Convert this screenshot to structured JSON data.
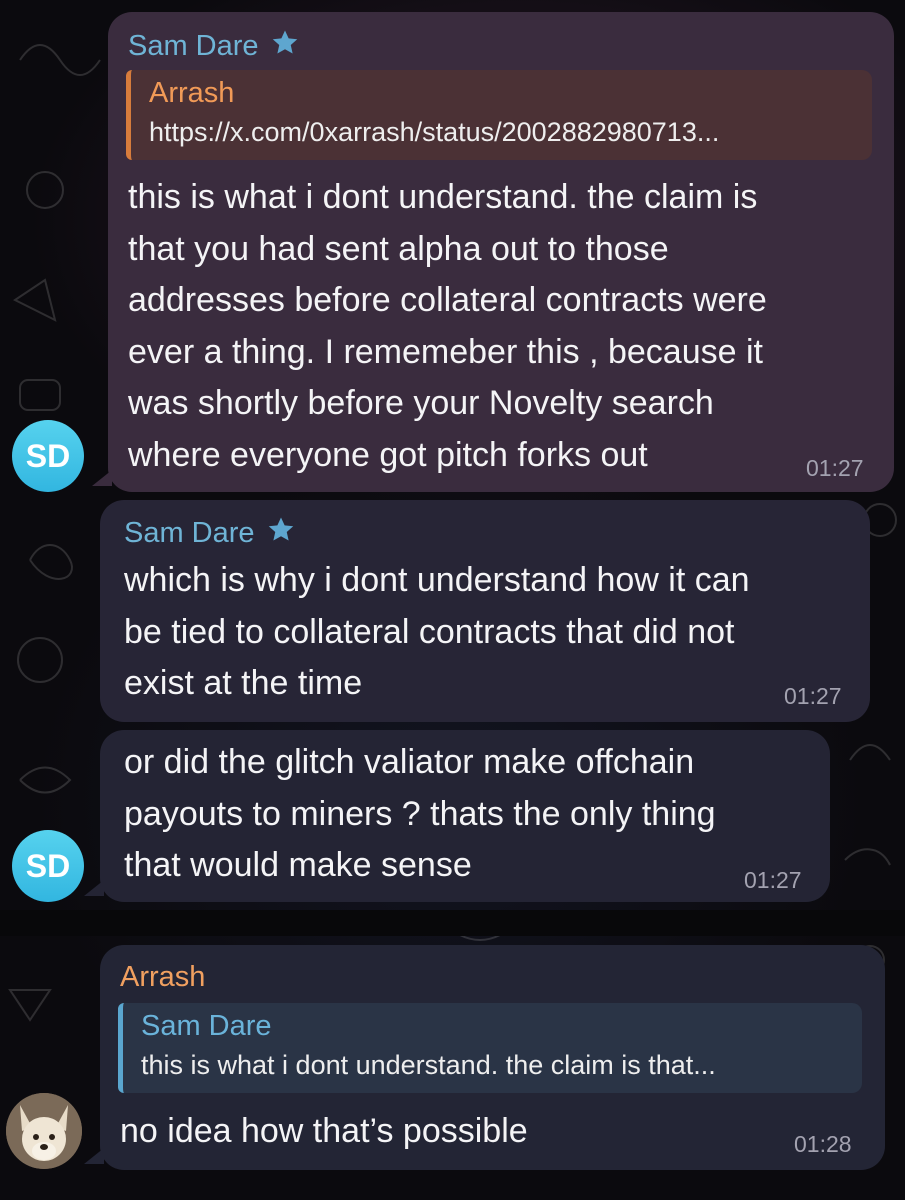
{
  "messages": [
    {
      "sender": "Sam Dare",
      "reply": {
        "name": "Arrash",
        "text": "https://x.com/0xarrash/status/2002882980713..."
      },
      "text": "this is what i dont understand. the claim is\nthat you had sent alpha out to those\naddresses before collateral contracts were\never a thing. I rememeber this , because it\nwas shortly before your Novelty search\nwhere everyone got pitch forks out",
      "time": "01:27",
      "avatar": "SD"
    },
    {
      "sender": "Sam Dare",
      "text": "which is why i dont understand how it can\nbe tied to collateral contracts that did not\nexist at the time",
      "time": "01:27"
    },
    {
      "text": "or did the glitch valiator make offchain\npayouts to miners ? thats the only thing\nthat would make sense",
      "time": "01:27",
      "avatar": "SD"
    },
    {
      "sender": "Arrash",
      "reply": {
        "name": "Sam Dare",
        "text": "this is what i dont understand. the claim is that..."
      },
      "text": "no idea how that’s possible",
      "time": "01:28"
    }
  ],
  "colors": {
    "sam_name": "#6fb4d6",
    "arrash_name": "#f0a060",
    "avatar_bg": "#3fc4e8"
  },
  "icons": [
    "star-icon",
    "dog-avatar"
  ]
}
